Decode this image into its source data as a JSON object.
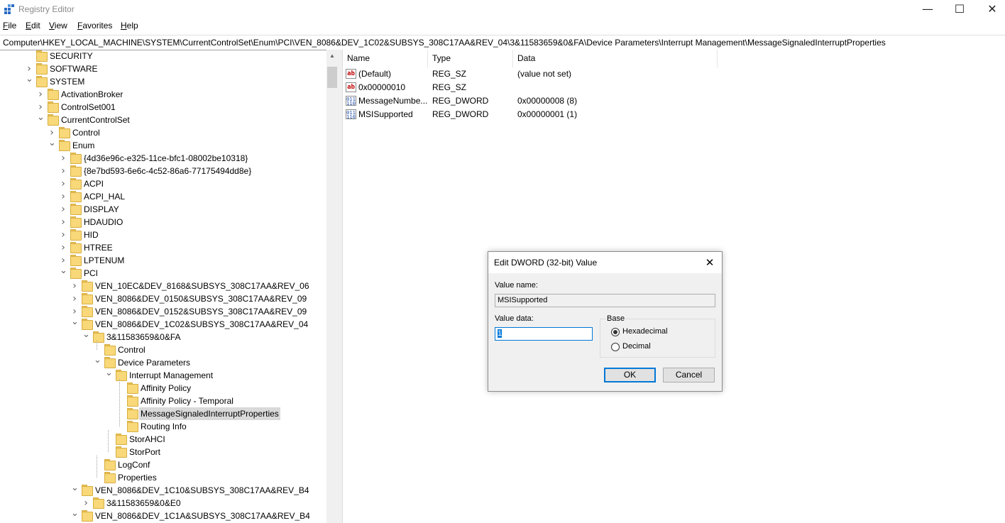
{
  "window": {
    "title": "Registry Editor",
    "controls": {
      "minimize": "—",
      "maximize": "☐",
      "close": "✕"
    }
  },
  "menu": [
    {
      "label": "File",
      "accel": "F",
      "rest": "ile"
    },
    {
      "label": "Edit",
      "accel": "E",
      "rest": "dit"
    },
    {
      "label": "View",
      "accel": "V",
      "rest": "iew"
    },
    {
      "label": "Favorites",
      "accel": "F",
      "rest": "avorites"
    },
    {
      "label": "Help",
      "accel": "H",
      "rest": "elp"
    }
  ],
  "address": "Computer\\HKEY_LOCAL_MACHINE\\SYSTEM\\CurrentControlSet\\Enum\\PCI\\VEN_8086&DEV_1C02&SUBSYS_308C17AA&REV_04\\3&11583659&0&FA\\Device Parameters\\Interrupt Management\\MessageSignaledInterruptProperties",
  "tree": {
    "items": [
      {
        "label": "SECURITY",
        "chevron": ""
      },
      {
        "label": "SOFTWARE",
        "chevron": ">"
      },
      {
        "label": "SYSTEM",
        "chevron": "v"
      },
      {
        "label": "ActivationBroker",
        "chevron": ">"
      },
      {
        "label": "ControlSet001",
        "chevron": ">"
      },
      {
        "label": "CurrentControlSet",
        "chevron": "v"
      },
      {
        "label": "Control",
        "chevron": ">"
      },
      {
        "label": "Enum",
        "chevron": "v"
      },
      {
        "label": "{4d36e96c-e325-11ce-bfc1-08002be10318}",
        "chevron": ">"
      },
      {
        "label": "{8e7bd593-6e6c-4c52-86a6-77175494dd8e}",
        "chevron": ">"
      },
      {
        "label": "ACPI",
        "chevron": ">"
      },
      {
        "label": "ACPI_HAL",
        "chevron": ">"
      },
      {
        "label": "DISPLAY",
        "chevron": ">"
      },
      {
        "label": "HDAUDIO",
        "chevron": ">"
      },
      {
        "label": "HID",
        "chevron": ">"
      },
      {
        "label": "HTREE",
        "chevron": ">"
      },
      {
        "label": "LPTENUM",
        "chevron": ">"
      },
      {
        "label": "PCI",
        "chevron": "v"
      },
      {
        "label": "VEN_10EC&DEV_8168&SUBSYS_308C17AA&REV_06",
        "chevron": ">"
      },
      {
        "label": "VEN_8086&DEV_0150&SUBSYS_308C17AA&REV_09",
        "chevron": ">"
      },
      {
        "label": "VEN_8086&DEV_0152&SUBSYS_308C17AA&REV_09",
        "chevron": ">"
      },
      {
        "label": "VEN_8086&DEV_1C02&SUBSYS_308C17AA&REV_04",
        "chevron": "v"
      },
      {
        "label": "3&11583659&0&FA",
        "chevron": "v"
      },
      {
        "label": "Control",
        "chevron": ""
      },
      {
        "label": "Device Parameters",
        "chevron": "v"
      },
      {
        "label": "Interrupt Management",
        "chevron": "v"
      },
      {
        "label": "Affinity Policy",
        "chevron": ""
      },
      {
        "label": "Affinity Policy - Temporal",
        "chevron": ""
      },
      {
        "label": "MessageSignaledInterruptProperties",
        "chevron": "",
        "selected": true
      },
      {
        "label": "Routing Info",
        "chevron": ""
      },
      {
        "label": "StorAHCI",
        "chevron": ""
      },
      {
        "label": "StorPort",
        "chevron": ""
      },
      {
        "label": "LogConf",
        "chevron": ""
      },
      {
        "label": "Properties",
        "chevron": ""
      },
      {
        "label": "VEN_8086&DEV_1C10&SUBSYS_308C17AA&REV_B4",
        "chevron": "v"
      },
      {
        "label": "3&11583659&0&E0",
        "chevron": ">"
      },
      {
        "label": "VEN_8086&DEV_1C1A&SUBSYS_308C17AA&REV_B4",
        "chevron": "v"
      }
    ]
  },
  "list": {
    "columns": [
      "Name",
      "Type",
      "Data"
    ],
    "rows": [
      {
        "icon": "string-value-icon",
        "name": "(Default)",
        "type": "REG_SZ",
        "data": "(value not set)"
      },
      {
        "icon": "string-value-icon",
        "name": "0x00000010",
        "type": "REG_SZ",
        "data": ""
      },
      {
        "icon": "dword-value-icon",
        "name": "MessageNumbe...",
        "type": "REG_DWORD",
        "data": "0x00000008 (8)"
      },
      {
        "icon": "dword-value-icon",
        "name": "MSISupported",
        "type": "REG_DWORD",
        "data": "0x00000001 (1)"
      }
    ]
  },
  "dialog": {
    "title": "Edit DWORD (32-bit) Value",
    "close": "✕",
    "value_name_label": "Value name:",
    "value_name": "MSISupported",
    "value_data_label": "Value data:",
    "value_data": "1",
    "base_label": "Base",
    "hex_label": "Hexadecimal",
    "dec_label": "Decimal",
    "base_selected": "Hexadecimal",
    "ok": "OK",
    "cancel": "Cancel"
  }
}
